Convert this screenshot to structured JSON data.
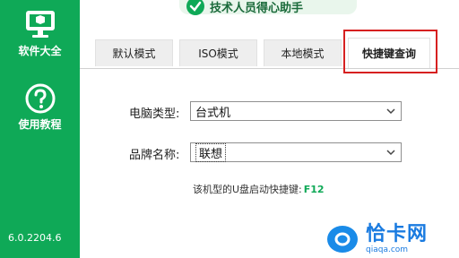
{
  "app": {
    "banner_title": "技术人员得心助手",
    "version": "6.0.2204.6"
  },
  "sidebar": {
    "items": [
      {
        "label": "软件大全",
        "icon": "monitor-icon"
      },
      {
        "label": "使用教程",
        "icon": "question-icon"
      }
    ]
  },
  "tabs": [
    {
      "label": "默认模式",
      "active": false
    },
    {
      "label": "ISO模式",
      "active": false
    },
    {
      "label": "本地模式",
      "active": false
    },
    {
      "label": "快捷键查询",
      "active": true
    }
  ],
  "form": {
    "computer_type_label": "电脑类型:",
    "computer_type_value": "台式机",
    "brand_label": "品牌名称:",
    "brand_value": "联想"
  },
  "result": {
    "text": "该机型的U盘启动快捷键:",
    "key": "F12"
  },
  "watermark": {
    "brand": "恰卡网",
    "domain": "qiaqa.com"
  },
  "colors": {
    "sidebar": "#0fa957",
    "accent": "#0fa957",
    "highlight": "#d62020"
  }
}
